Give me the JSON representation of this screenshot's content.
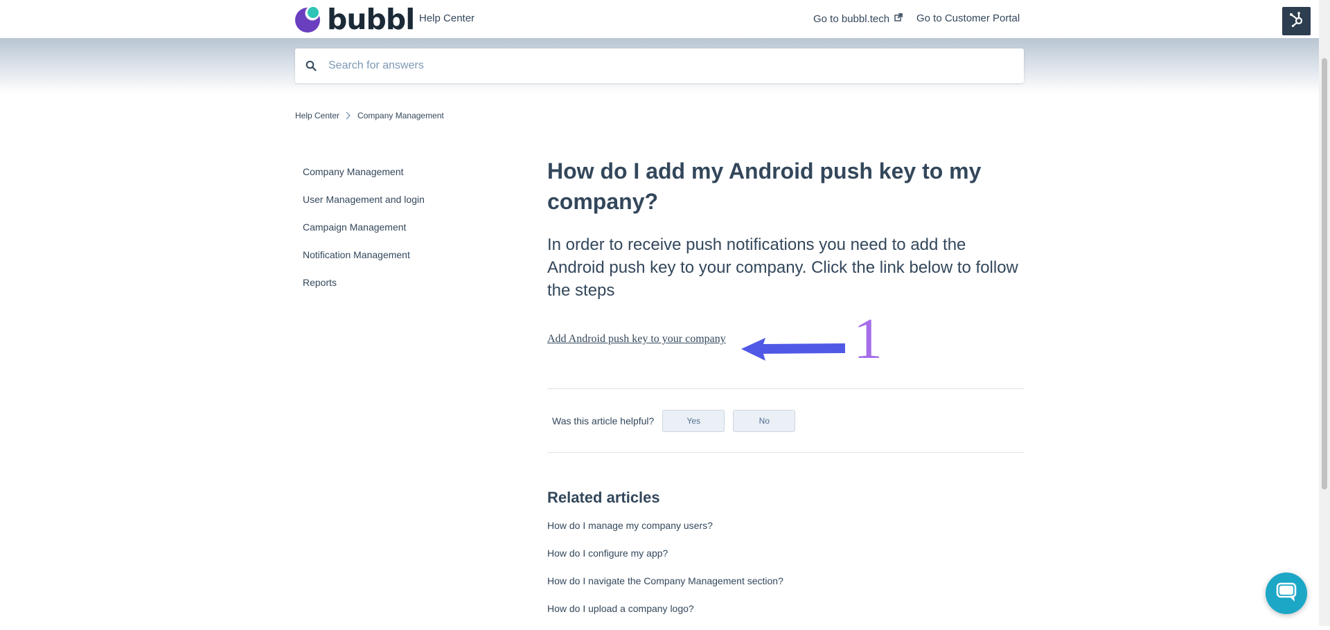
{
  "header": {
    "brand": "bubbl",
    "help_center_label": "Help Center",
    "nav_bubbl_label": "Go to bubbl.tech",
    "nav_portal_label": "Go to Customer Portal",
    "brand_colors": {
      "purple": "#6a3fbf",
      "teal": "#2ec4b6",
      "dark": "#1b2a36"
    }
  },
  "search": {
    "placeholder": "Search for answers",
    "value": ""
  },
  "breadcrumb": {
    "items": [
      "Help Center",
      "Company Management"
    ]
  },
  "sidebar": {
    "items": [
      {
        "label": "Company Management"
      },
      {
        "label": "User Management and login"
      },
      {
        "label": "Campaign Management"
      },
      {
        "label": "Notification Management"
      },
      {
        "label": "Reports"
      }
    ]
  },
  "article": {
    "title": "How do I add my Android push key to my company?",
    "intro": "In order to receive push notifications you need to add the Android push key to your company. Click the link below to follow the steps",
    "link_label": "Add Android push key to your company",
    "annotation_number": "1",
    "annotation_arrow_color": "#5059e6",
    "annotation_number_color": "#a56ee8"
  },
  "feedback": {
    "question": "Was this article helpful?",
    "yes_label": "Yes",
    "no_label": "No"
  },
  "related": {
    "title": "Related articles",
    "items": [
      "How do I manage my company users?",
      "How do I configure my app?",
      "How do I navigate the Company Management section?",
      "How do I upload a company logo?"
    ]
  },
  "icons": {
    "search": "search-icon",
    "breadcrumb_separator": "chevron-right-icon",
    "external_link": "external-link-icon",
    "hubspot": "hubspot-sprocket-icon",
    "chat": "chat-bubble-icon"
  }
}
